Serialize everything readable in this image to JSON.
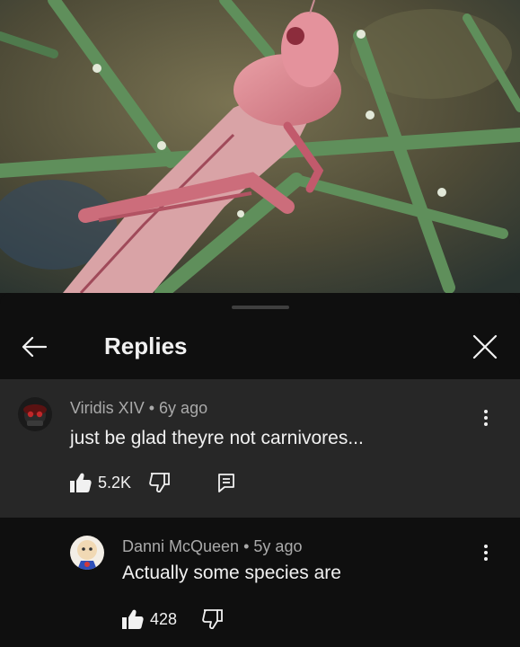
{
  "header": {
    "title": "Replies"
  },
  "parent_comment": {
    "author": "Viridis XIV",
    "separator": "•",
    "age": "6y ago",
    "text": "just be glad theyre not carnivores...",
    "likes": "5.2K"
  },
  "reply_comment": {
    "author": "Danni McQueen",
    "separator": "•",
    "age": "5y ago",
    "text": "Actually some species are",
    "likes": "428"
  },
  "icons": {
    "back": "arrow-left-icon",
    "close": "close-icon",
    "like": "thumbs-up-icon",
    "dislike": "thumbs-down-icon",
    "reply": "comment-reply-icon",
    "more": "more-vertical-icon"
  },
  "colors": {
    "background": "#0f0f0f",
    "highlight_row": "#272727",
    "text_primary": "#f1f1f1",
    "text_secondary": "#aaaaaa"
  }
}
